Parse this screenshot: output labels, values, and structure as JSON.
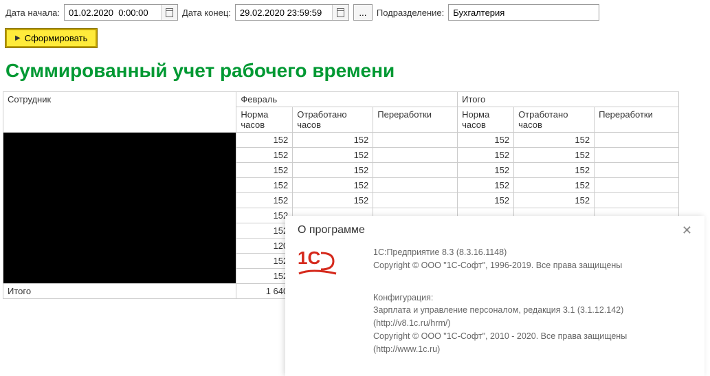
{
  "toolbar": {
    "date_from_label": "Дата начала:",
    "date_from_value": "01.02.2020  0:00:00",
    "date_to_label": "Дата конец:",
    "date_to_value": "29.02.2020 23:59:59",
    "ellipsis": "...",
    "dept_label": "Подразделение:",
    "dept_value": "Бухгалтерия",
    "form_button": "Сформировать"
  },
  "report": {
    "title": "Суммированный учет рабочего времени",
    "col_employee": "Сотрудник",
    "col_month": "Февраль",
    "col_total": "Итого",
    "sub_norm": "Норма часов",
    "sub_worked": "Отработано часов",
    "sub_over": "Переработки",
    "rows": [
      {
        "norm": "152",
        "worked": "152",
        "t_norm": "152",
        "t_worked": "152"
      },
      {
        "norm": "152",
        "worked": "152",
        "t_norm": "152",
        "t_worked": "152"
      },
      {
        "norm": "152",
        "worked": "152",
        "t_norm": "152",
        "t_worked": "152"
      },
      {
        "norm": "152",
        "worked": "152",
        "t_norm": "152",
        "t_worked": "152"
      },
      {
        "norm": "152",
        "worked": "152",
        "t_norm": "152",
        "t_worked": "152"
      },
      {
        "norm": "152",
        "worked": "",
        "t_norm": "",
        "t_worked": ""
      },
      {
        "norm": "152",
        "worked": "",
        "t_norm": "",
        "t_worked": ""
      },
      {
        "norm": "120",
        "worked": "",
        "t_norm": "",
        "t_worked": ""
      },
      {
        "norm": "152",
        "worked": "",
        "t_norm": "",
        "t_worked": ""
      },
      {
        "norm": "152",
        "worked": "",
        "t_norm": "",
        "t_worked": ""
      }
    ],
    "total_label": "Итого",
    "total_norm": "1 640"
  },
  "about": {
    "title": "О программе",
    "line1": "1С:Предприятие 8.3 (8.3.16.1148)",
    "line2": "Copyright © ООО \"1С-Софт\", 1996-2019. Все права защищены",
    "conf_header": "Конфигурация:",
    "conf_line1": "Зарплата и управление персоналом, редакция 3.1 (3.1.12.142) (http://v8.1c.ru/hrm/)",
    "conf_line2": "Copyright © ООО \"1С-Софт\", 2010 - 2020. Все права защищены",
    "conf_line3": "(http://www.1c.ru)"
  }
}
